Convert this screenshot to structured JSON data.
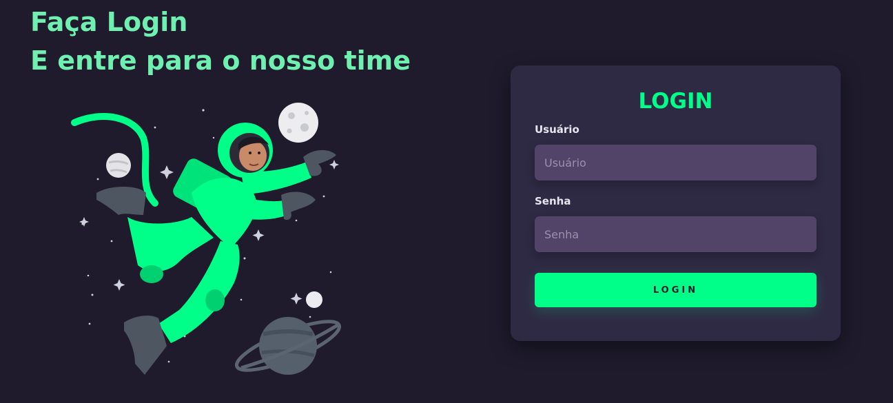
{
  "header": {
    "line1": "Faça Login",
    "line2": "E entre para o nosso time"
  },
  "login_card": {
    "title": "LOGIN",
    "username": {
      "label": "Usuário",
      "placeholder": "Usuário",
      "value": ""
    },
    "password": {
      "label": "Senha",
      "placeholder": "Senha",
      "value": ""
    },
    "submit_label": "LOGIN"
  },
  "illustration": {
    "subject": "astronaut-floating-in-space-icon"
  },
  "colors": {
    "background": "#1f1b2d",
    "accent_green": "#00ff88",
    "headline_green": "#6ff0b0",
    "card": "#2f2a44",
    "input": "#514468"
  }
}
